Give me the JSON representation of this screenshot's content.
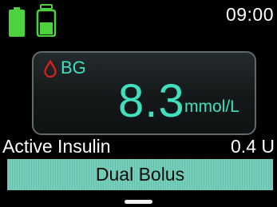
{
  "status_bar": {
    "time": "09:00",
    "battery_icon": "battery-full-icon",
    "reservoir_icon": "insulin-reservoir-icon",
    "battery_color": "#4cd23c"
  },
  "bg_panel": {
    "icon": "blood-drop-icon",
    "label": "BG",
    "value": "8.3",
    "unit": "mmol/L",
    "accent_color": "#3fe0c0",
    "drop_color": "#e0201a"
  },
  "active_insulin": {
    "label": "Active Insulin",
    "value": "0.4 U"
  },
  "action": {
    "label": "Dual Bolus",
    "color": "#74d0bc"
  }
}
